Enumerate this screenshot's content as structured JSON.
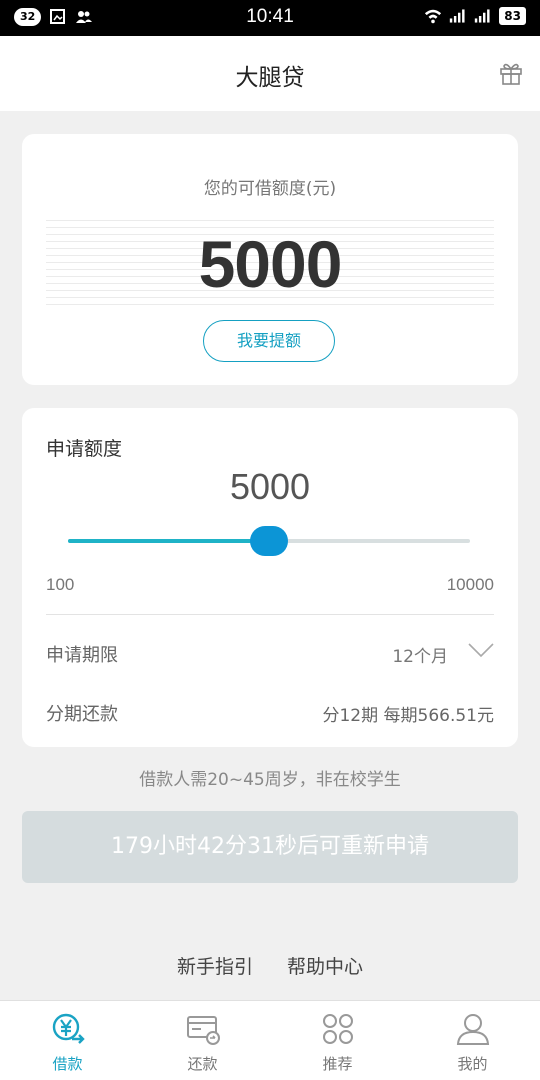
{
  "status_bar": {
    "notif_count": "32",
    "time": "10:41",
    "battery": "83"
  },
  "header": {
    "title": "大腿贷",
    "gift_icon": "gift-icon"
  },
  "credit_card": {
    "subtitle": "您的可借额度(元)",
    "amount": "5000",
    "raise_button": "我要提额"
  },
  "apply_card": {
    "label": "申请额度",
    "value": "5000",
    "slider": {
      "min": 100,
      "max": 10000,
      "value": 5000,
      "position_fraction": 0.5
    },
    "min_label": "100",
    "max_label": "10000",
    "term_label": "申请期限",
    "term_value": "12个月",
    "installment_label": "分期还款",
    "installment_value": "分12期  每期566.51元"
  },
  "notice": "借款人需20~45周岁，非在校学生",
  "reapply_button": "179小时42分31秒后可重新申请",
  "links": {
    "guide": "新手指引",
    "help": "帮助中心"
  },
  "tabs": [
    {
      "label": "借款",
      "icon": "yen-icon",
      "active": true
    },
    {
      "label": "还款",
      "icon": "card-icon",
      "active": false
    },
    {
      "label": "推荐",
      "icon": "clover-icon",
      "active": false
    },
    {
      "label": "我的",
      "icon": "user-icon",
      "active": false
    }
  ],
  "colors": {
    "accent": "#1aa3c4",
    "slider_thumb": "#0c95d6",
    "disabled_button": "#d5dcde"
  }
}
